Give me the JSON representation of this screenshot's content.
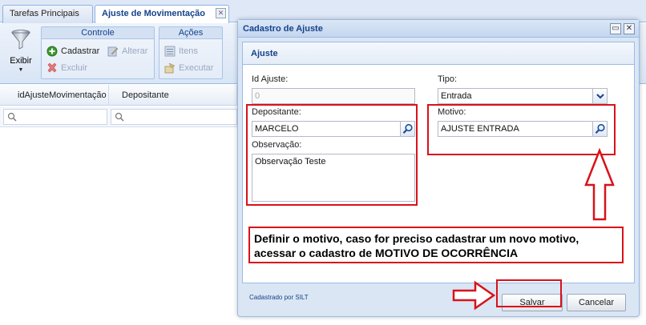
{
  "tabs": [
    {
      "label": "Tarefas Principais"
    },
    {
      "label": "Ajuste de Movimentação"
    }
  ],
  "toolbar": {
    "filter_label": "Exibir",
    "groups": {
      "controle": {
        "title": "Controle",
        "cadastrar": "Cadastrar",
        "excluir": "Excluir",
        "alterar": "Alterar"
      },
      "acoes": {
        "title": "Ações",
        "itens": "Itens",
        "executar": "Executar"
      }
    }
  },
  "grid": {
    "columns": [
      "idAjusteMovimentação",
      "Depositante"
    ]
  },
  "window": {
    "title": "Cadastro de Ajuste",
    "panel_title": "Ajuste",
    "fields": {
      "id_ajuste": {
        "label": "Id Ajuste:",
        "value": "0"
      },
      "tipo": {
        "label": "Tipo:",
        "value": "Entrada"
      },
      "depositante": {
        "label": "Depositante:",
        "value": "MARCELO"
      },
      "motivo": {
        "label": "Motivo:",
        "value": "AJUSTE ENTRADA"
      },
      "observacao": {
        "label": "Observação:",
        "value": "Observação Teste"
      }
    },
    "footer_text": "Cadastrado por SILT",
    "save_label": "Salvar",
    "cancel_label": "Cancelar"
  },
  "annotation": {
    "note_line1": "Definir o motivo, caso for preciso cadastrar um novo motivo,",
    "note_line2": "acessar o cadastro de MOTIVO DE OCORRÊNCIA"
  },
  "colors": {
    "highlight_red": "#d8121a",
    "header_blue": "#15428b"
  }
}
